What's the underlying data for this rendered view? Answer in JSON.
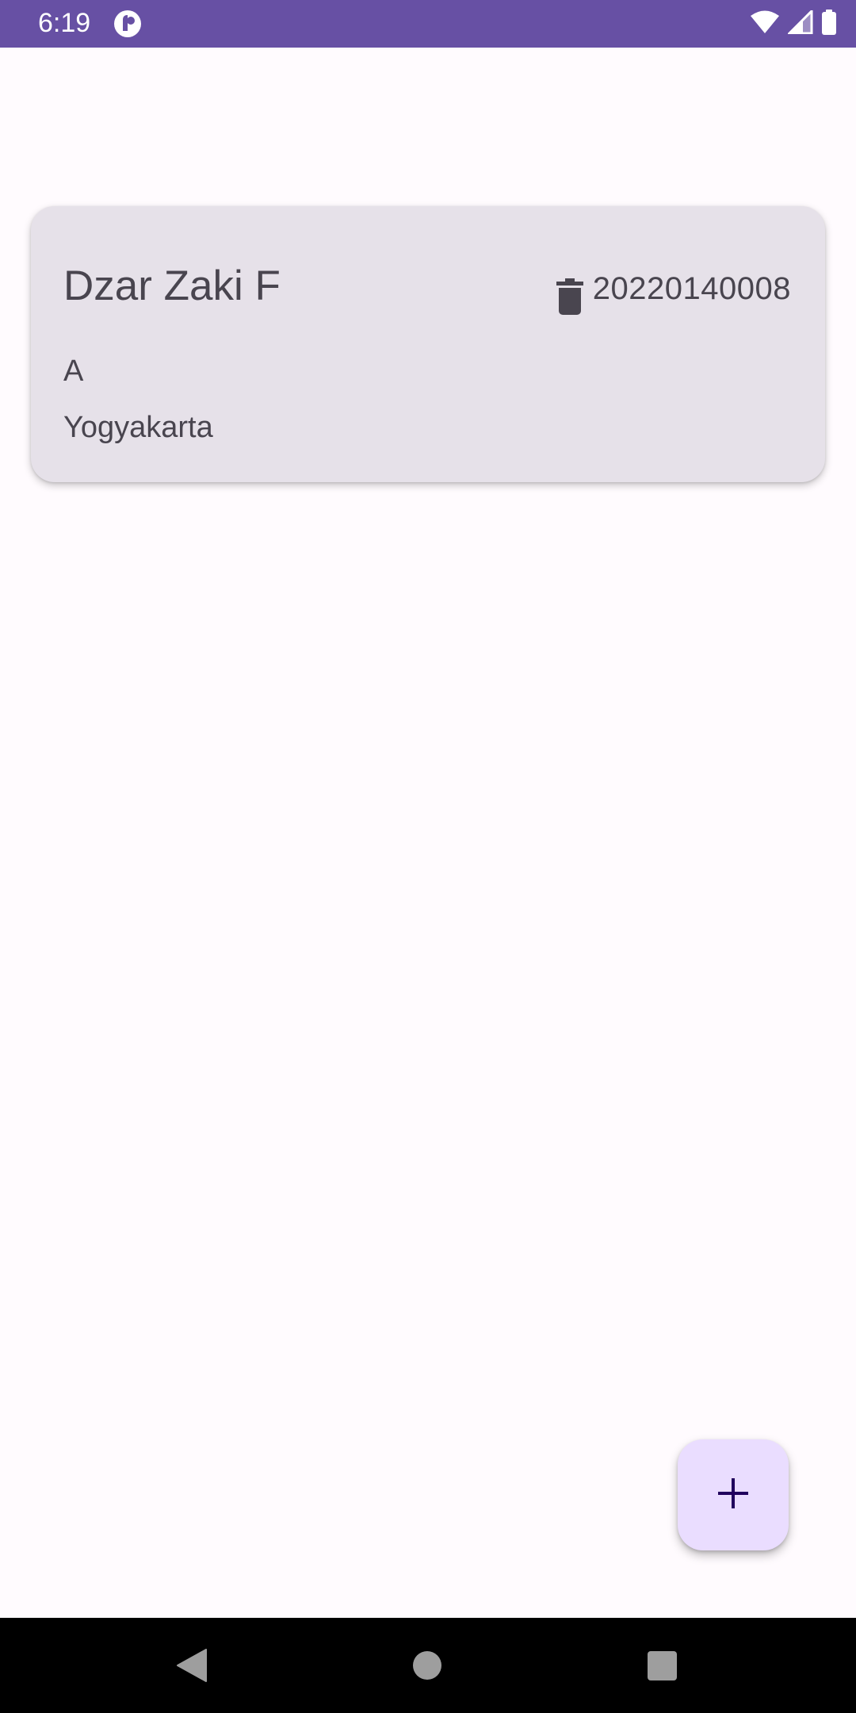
{
  "status_bar": {
    "time": "6:19",
    "background": "#6750A4",
    "icons": [
      "app-notification-icon",
      "wifi-icon",
      "cellular-signal-icon",
      "battery-icon"
    ]
  },
  "student_card": {
    "name": "Dzar Zaki F",
    "nim": "20220140008",
    "class": "A",
    "city": "Yogyakarta",
    "delete_icon": "trash-icon",
    "background": "#E6E1E9"
  },
  "fab": {
    "icon": "plus-icon",
    "background": "#EADDFF",
    "icon_color": "#21005D"
  },
  "navigation_bar": {
    "icons": [
      "back-icon",
      "home-icon",
      "recents-icon"
    ]
  }
}
